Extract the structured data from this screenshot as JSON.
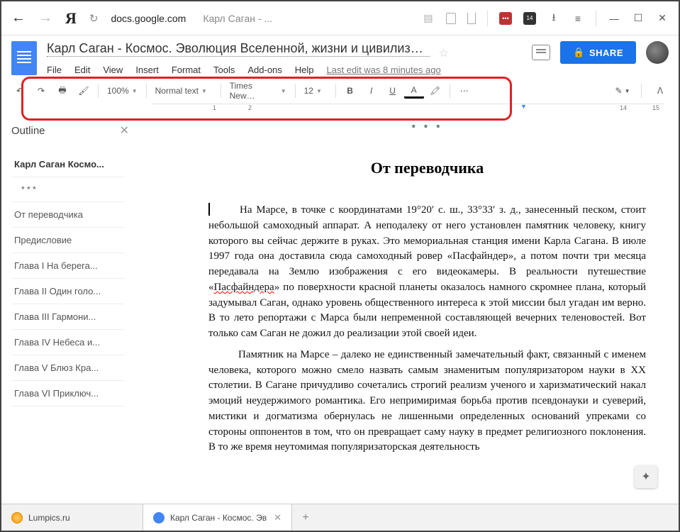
{
  "browser": {
    "host": "docs.google.com",
    "page_title": "Карл Саган - ...",
    "ext_badge": "14",
    "ext_lastpass": "•••"
  },
  "doc": {
    "title": "Карл Саган - Космос. Эволюция Вселенной, жизни и цивилиза…",
    "menu": {
      "file": "File",
      "edit": "Edit",
      "view": "View",
      "insert": "Insert",
      "format": "Format",
      "tools": "Tools",
      "addons": "Add-ons",
      "help": "Help",
      "last_edit": "Last edit was 8 minutes ago"
    },
    "toolbar": {
      "zoom": "100%",
      "style": "Normal text",
      "font": "Times New…",
      "size": "12"
    },
    "share": "SHARE"
  },
  "outline": {
    "title": "Outline",
    "items": [
      {
        "label": "Карл Саган Космо...",
        "bold": true
      },
      {
        "label": "* * *",
        "sub": true
      },
      {
        "label": "От переводчика"
      },
      {
        "label": "Предисловие"
      },
      {
        "label": "Глава I На берега..."
      },
      {
        "label": "Глава II Один голо..."
      },
      {
        "label": "Глава III Гармони..."
      },
      {
        "label": "Глава IV Небеса и..."
      },
      {
        "label": "Глава V Блюз Кра..."
      },
      {
        "label": "Глава VI Приключ..."
      }
    ]
  },
  "content": {
    "separator": "* * *",
    "heading": "От переводчика",
    "p1a": "На Марсе, в точке с координатами 19°20′ с. ш., 33°33′ з. д., занесенный песком, стоит небольшой самоходный аппарат. А неподалеку от него установлен памятник человеку, книгу которого вы сейчас держите в руках. Это мемориальная станция имени Карла Сагана. В июле 1997 года она доставила сюда самоходный ровер «Пасфайндер», а потом почти три месяца передавала на Землю изображения с его видеокамеры. В реальности путешествие «",
    "p1err": "Пасфайндера",
    "p1b": "» по поверхности красной планеты оказалось намного скромнее плана, который задумывал Саган, однако уровень общественного интереса к этой миссии был угадан им верно. В то лето репортажи с Марса были непременной составляющей вечерних теленовостей. Вот только сам Саган не дожил до реализации этой своей идеи.",
    "p2": "Памятник на Марсе – далеко не единственный замечательный факт, связанный с именем человека, которого можно смело назвать самым знаменитым популяризатором науки в XX столетии. В Сагане причудливо сочетались строгий реализм ученого и харизматический накал эмоций неудержимого романтика. Его непримиримая борьба против псевдонауки и суеверий, мистики и догматизма обернулась не лишенными определенных оснований упреками со стороны оппонентов в том, что он превращает саму науку в предмет религиозного поклонения. В то же время неутомимая популяризаторская деятельность"
  },
  "tabs": {
    "t1": "Lumpics.ru",
    "t2": "Карл Саган - Космос. Эв"
  }
}
